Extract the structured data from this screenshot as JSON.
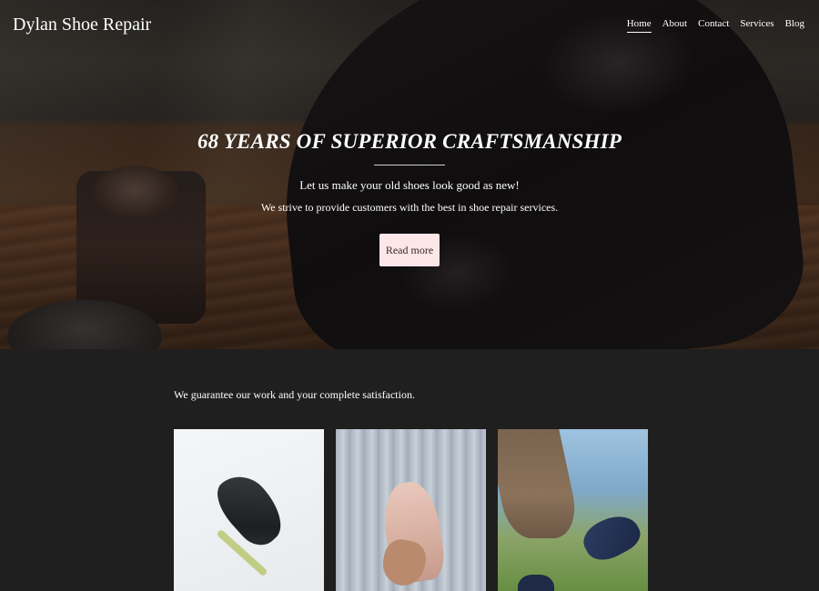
{
  "site": {
    "brand": "Dylan Shoe Repair"
  },
  "nav": {
    "items": [
      {
        "label": "Home",
        "active": true
      },
      {
        "label": "About",
        "active": false
      },
      {
        "label": "Contact",
        "active": false
      },
      {
        "label": "Services",
        "active": false
      },
      {
        "label": "Blog",
        "active": false
      }
    ]
  },
  "hero": {
    "title": "68 YEARS OF SUPERIOR CRAFTSMANSHIP",
    "line1": "Let us make your old shoes look good as new!",
    "line2": "We strive to provide customers with the best in shoe repair services.",
    "button_label": "Read more"
  },
  "main": {
    "guarantee": "We guarantee our work and your complete satisfaction."
  },
  "colors": {
    "button_bg": "#fde6e8",
    "page_bg": "#1f1f1f"
  }
}
